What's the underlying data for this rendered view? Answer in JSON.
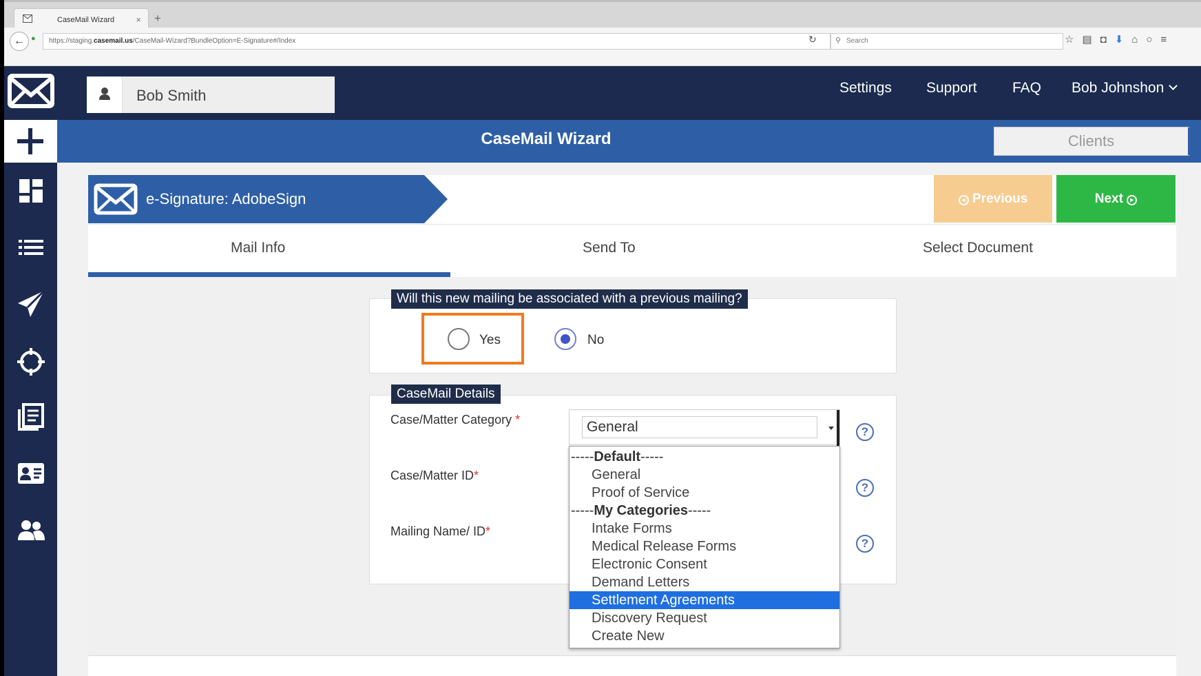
{
  "browser": {
    "tab_title": "CaseMail Wizard",
    "url_prefix": "https://staging.",
    "url_domain": "casemail.us",
    "url_path": "/CaseMail-Wizard?BundleOption=E-Signature#/Index",
    "search_placeholder": "Search"
  },
  "header": {
    "user_name": "Bob Smith",
    "nav": [
      "Settings",
      "Support",
      "FAQ"
    ],
    "account": "Bob Johnshon"
  },
  "titlebar": {
    "title": "CaseMail Wizard",
    "clients_label": "Clients"
  },
  "wizard": {
    "ribbon_label": "e-Signature: AdobeSign",
    "previous_label": "Previous",
    "next_label": "Next",
    "tabs": [
      "Mail Info",
      "Send To",
      "Select Document"
    ],
    "active_tab": "Mail Info"
  },
  "association": {
    "question": "Will this new mailing be associated with a previous mailing?",
    "options": [
      "Yes",
      "No"
    ],
    "selected": "No"
  },
  "details": {
    "legend": "CaseMail Details",
    "category_label": "Case/Matter Category",
    "id_label": "Case/Matter ID",
    "mailing_label": "Mailing Name/ ID",
    "required_mark": "*",
    "help_glyph": "?",
    "category_value": "General"
  },
  "dropdown": {
    "items": [
      {
        "text": "-----Default-----",
        "prefix": "-----",
        "label": "Default",
        "suffix": "-----",
        "group": true
      },
      {
        "text": "General"
      },
      {
        "text": "Proof of Service"
      },
      {
        "text": "-----My Categories-----",
        "prefix": "-----",
        "label": "My Categories",
        "suffix": "-----",
        "group": true
      },
      {
        "text": "Intake Forms"
      },
      {
        "text": "Medical Release Forms"
      },
      {
        "text": "Electronic Consent"
      },
      {
        "text": "Demand Letters"
      },
      {
        "text": "Settlement Agreements",
        "selected": true
      },
      {
        "text": "Discovery Request"
      },
      {
        "text": "Create New"
      }
    ]
  },
  "colors": {
    "header_navy": "#1b2a4e",
    "accent_blue": "#2e5fa6",
    "next_green": "#2db845",
    "previous_peach": "#f6cc90",
    "highlight_orange": "#f07a1f",
    "selection_blue": "#1f6fe0"
  },
  "icons": {
    "sidebar": [
      "plus-icon",
      "dashboard-icon",
      "list-icon",
      "send-icon",
      "target-icon",
      "document-icon",
      "contact-card-icon",
      "users-icon"
    ]
  }
}
